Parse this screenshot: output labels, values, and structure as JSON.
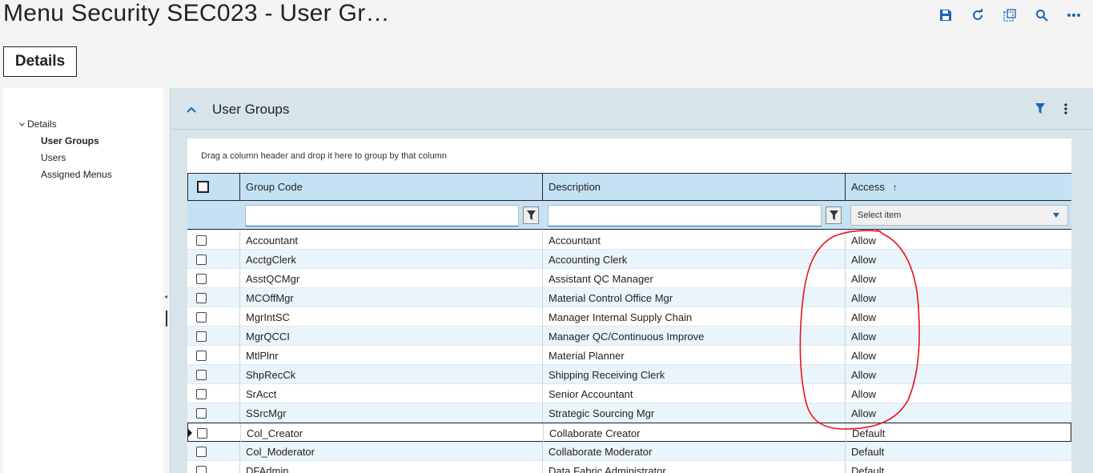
{
  "page": {
    "title": "Menu Security SEC023 - User Gr…",
    "details_tab": "Details"
  },
  "toolbar": {
    "icons": [
      "save-icon",
      "refresh-icon",
      "select-region-icon",
      "search-icon",
      "more-icon"
    ]
  },
  "nav": {
    "root": "Details",
    "items": [
      "User Groups",
      "Users",
      "Assigned Menus"
    ]
  },
  "panel": {
    "title": "User Groups",
    "drag_hint": "Drag a column header and drop it here to group by that column"
  },
  "grid": {
    "columns": {
      "group_code": "Group Code",
      "description": "Description",
      "access": "Access"
    },
    "access_sort": "↑",
    "filter_select_placeholder": "Select item",
    "rows": [
      {
        "code": "Accountant",
        "desc": "Accountant",
        "access": "Allow"
      },
      {
        "code": "AcctgClerk",
        "desc": "Accounting Clerk",
        "access": "Allow"
      },
      {
        "code": "AsstQCMgr",
        "desc": "Assistant QC Manager",
        "access": "Allow"
      },
      {
        "code": "MCOffMgr",
        "desc": "Material Control Office Mgr",
        "access": "Allow"
      },
      {
        "code": "MgrIntSC",
        "desc": "Manager Internal Supply Chain",
        "access": "Allow"
      },
      {
        "code": "MgrQCCI",
        "desc": "Manager QC/Continuous Improve",
        "access": "Allow"
      },
      {
        "code": "MtlPlnr",
        "desc": "Material Planner",
        "access": "Allow"
      },
      {
        "code": "ShpRecCk",
        "desc": "Shipping Receiving Clerk",
        "access": "Allow"
      },
      {
        "code": "SrAcct",
        "desc": "Senior Accountant",
        "access": "Allow"
      },
      {
        "code": "SSrcMgr",
        "desc": "Strategic Sourcing Mgr",
        "access": "Allow"
      },
      {
        "code": "Col_Creator",
        "desc": "Collaborate Creator",
        "access": "Default"
      },
      {
        "code": "Col_Moderator",
        "desc": "Collaborate Moderator",
        "access": "Default"
      },
      {
        "code": "DFAdmin",
        "desc": "Data Fabric Administrator",
        "access": "Default"
      }
    ]
  },
  "colors": {
    "accent": "#1b64b4",
    "header_bg": "#c5e2f5",
    "panel_bg": "#d7e4ea",
    "annotation": "#e8141a"
  }
}
